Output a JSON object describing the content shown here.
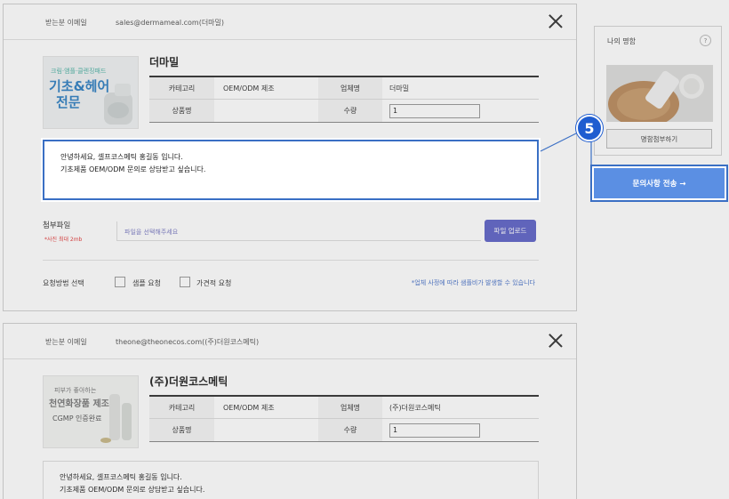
{
  "inquiries": [
    {
      "recipient_label": "받는분 이메일",
      "recipient_email": "sales@dermameal.com(더마밀)",
      "product_image_text": "크림·앰플·클렌징패드 기초&헤어 전문",
      "company_name": "더마밀",
      "category_label": "카테고리",
      "category_value": "OEM/ODM 제조",
      "company_label": "업체명",
      "company_value": "더마밀",
      "product_label": "상품명",
      "product_value": "",
      "quantity_label": "수량",
      "quantity_value": "1",
      "message_line1": "안녕하세요, 셀프코스메틱 홍길동 입니다.",
      "message_line2": "기초제품 OEM/ODM 문의로 상담받고 싶습니다."
    },
    {
      "recipient_label": "받는분 이메일",
      "recipient_email": "theone@theonecos.com((주)더원코스메틱)",
      "product_image_text": "피부가 좋아하는 천연화장품 제조 CGMP 인증완료",
      "company_name": "(주)더원코스메틱",
      "category_label": "카테고리",
      "category_value": "OEM/ODM 제조",
      "company_label": "업체명",
      "company_value": "(주)더원코스메틱",
      "product_label": "상품명",
      "product_value": "",
      "quantity_label": "수량",
      "quantity_value": "1",
      "message_line1": "안녕하세요, 셀프코스메틱 홍길동 입니다.",
      "message_line2": "기초제품 OEM/ODM 문의로 상담받고 싶습니다."
    }
  ],
  "attachment": {
    "label": "첨부파일",
    "note": "*사진 최대 2mb",
    "placeholder": "파일을 선택해주세요",
    "upload_label": "파일 업로드"
  },
  "request": {
    "label": "요청방법 선택",
    "option_sample": "샘플 요청",
    "option_quote": "가견적 요청",
    "note": "*업체 사정에 따라 샘플비가 발생할 수 있습니다"
  },
  "sidebar": {
    "title": "나의 명함",
    "help_icon": "?",
    "attach_card_label": "명함첨부하기",
    "send_label": "문의사항 전송 →"
  },
  "tutorial": {
    "step_number": "5"
  },
  "colors": {
    "highlight": "#3a6fc4",
    "send_button": "#5b8fe3",
    "upload_button": "#5f63c7",
    "badge": "#1f5dd0",
    "note_red": "#e23a3a",
    "note_blue": "#4a73c9"
  }
}
